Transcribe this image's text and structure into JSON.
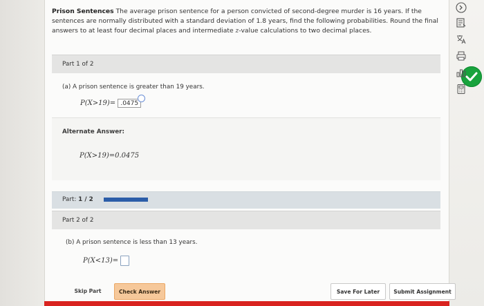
{
  "problem": {
    "title": "Prison Sentences",
    "text_before_16": "The average prison sentence for a person convicted of second-degree murder is",
    "mean": "16",
    "text_after_16": "years. If the sentences are normally distributed with a standard deviation of",
    "sd": "1.8",
    "text_after_sd": "years, find the following probabilities. Round the final answers to at least four decimal places and intermediate",
    "z_var": "z",
    "text_end": "-value calculations to two decimal places."
  },
  "part1": {
    "header": "Part 1 of 2",
    "question": "(a) A prison sentence is greater than 19 years.",
    "expr": "P(X>19)=",
    "answer": ".0475",
    "alt_label": "Alternate Answer:",
    "alt_expr": "P(X>19)=0.0475"
  },
  "progress": {
    "label_prefix": "Part:",
    "label_value": "1 / 2",
    "fraction": 0.5
  },
  "part2": {
    "header": "Part 2 of 2",
    "question": "(b) A prison sentence is less than 13 years.",
    "expr": "P(X<13)=",
    "answer_placeholder": ""
  },
  "footer": {
    "skip": "Skip Part",
    "check": "Check Answer",
    "save": "Save For Later",
    "submit": "Submit Assignment"
  },
  "colors": {
    "accent_check": "#18a33d",
    "progress_fill": "#2b5da8",
    "check_btn": "#f6c89a",
    "bottom_strip": "#d9231f"
  },
  "toolbar_icons": [
    "collapse-icon",
    "ebook-icon",
    "translate-icon",
    "print-icon",
    "data-icon",
    "calculator-icon"
  ]
}
